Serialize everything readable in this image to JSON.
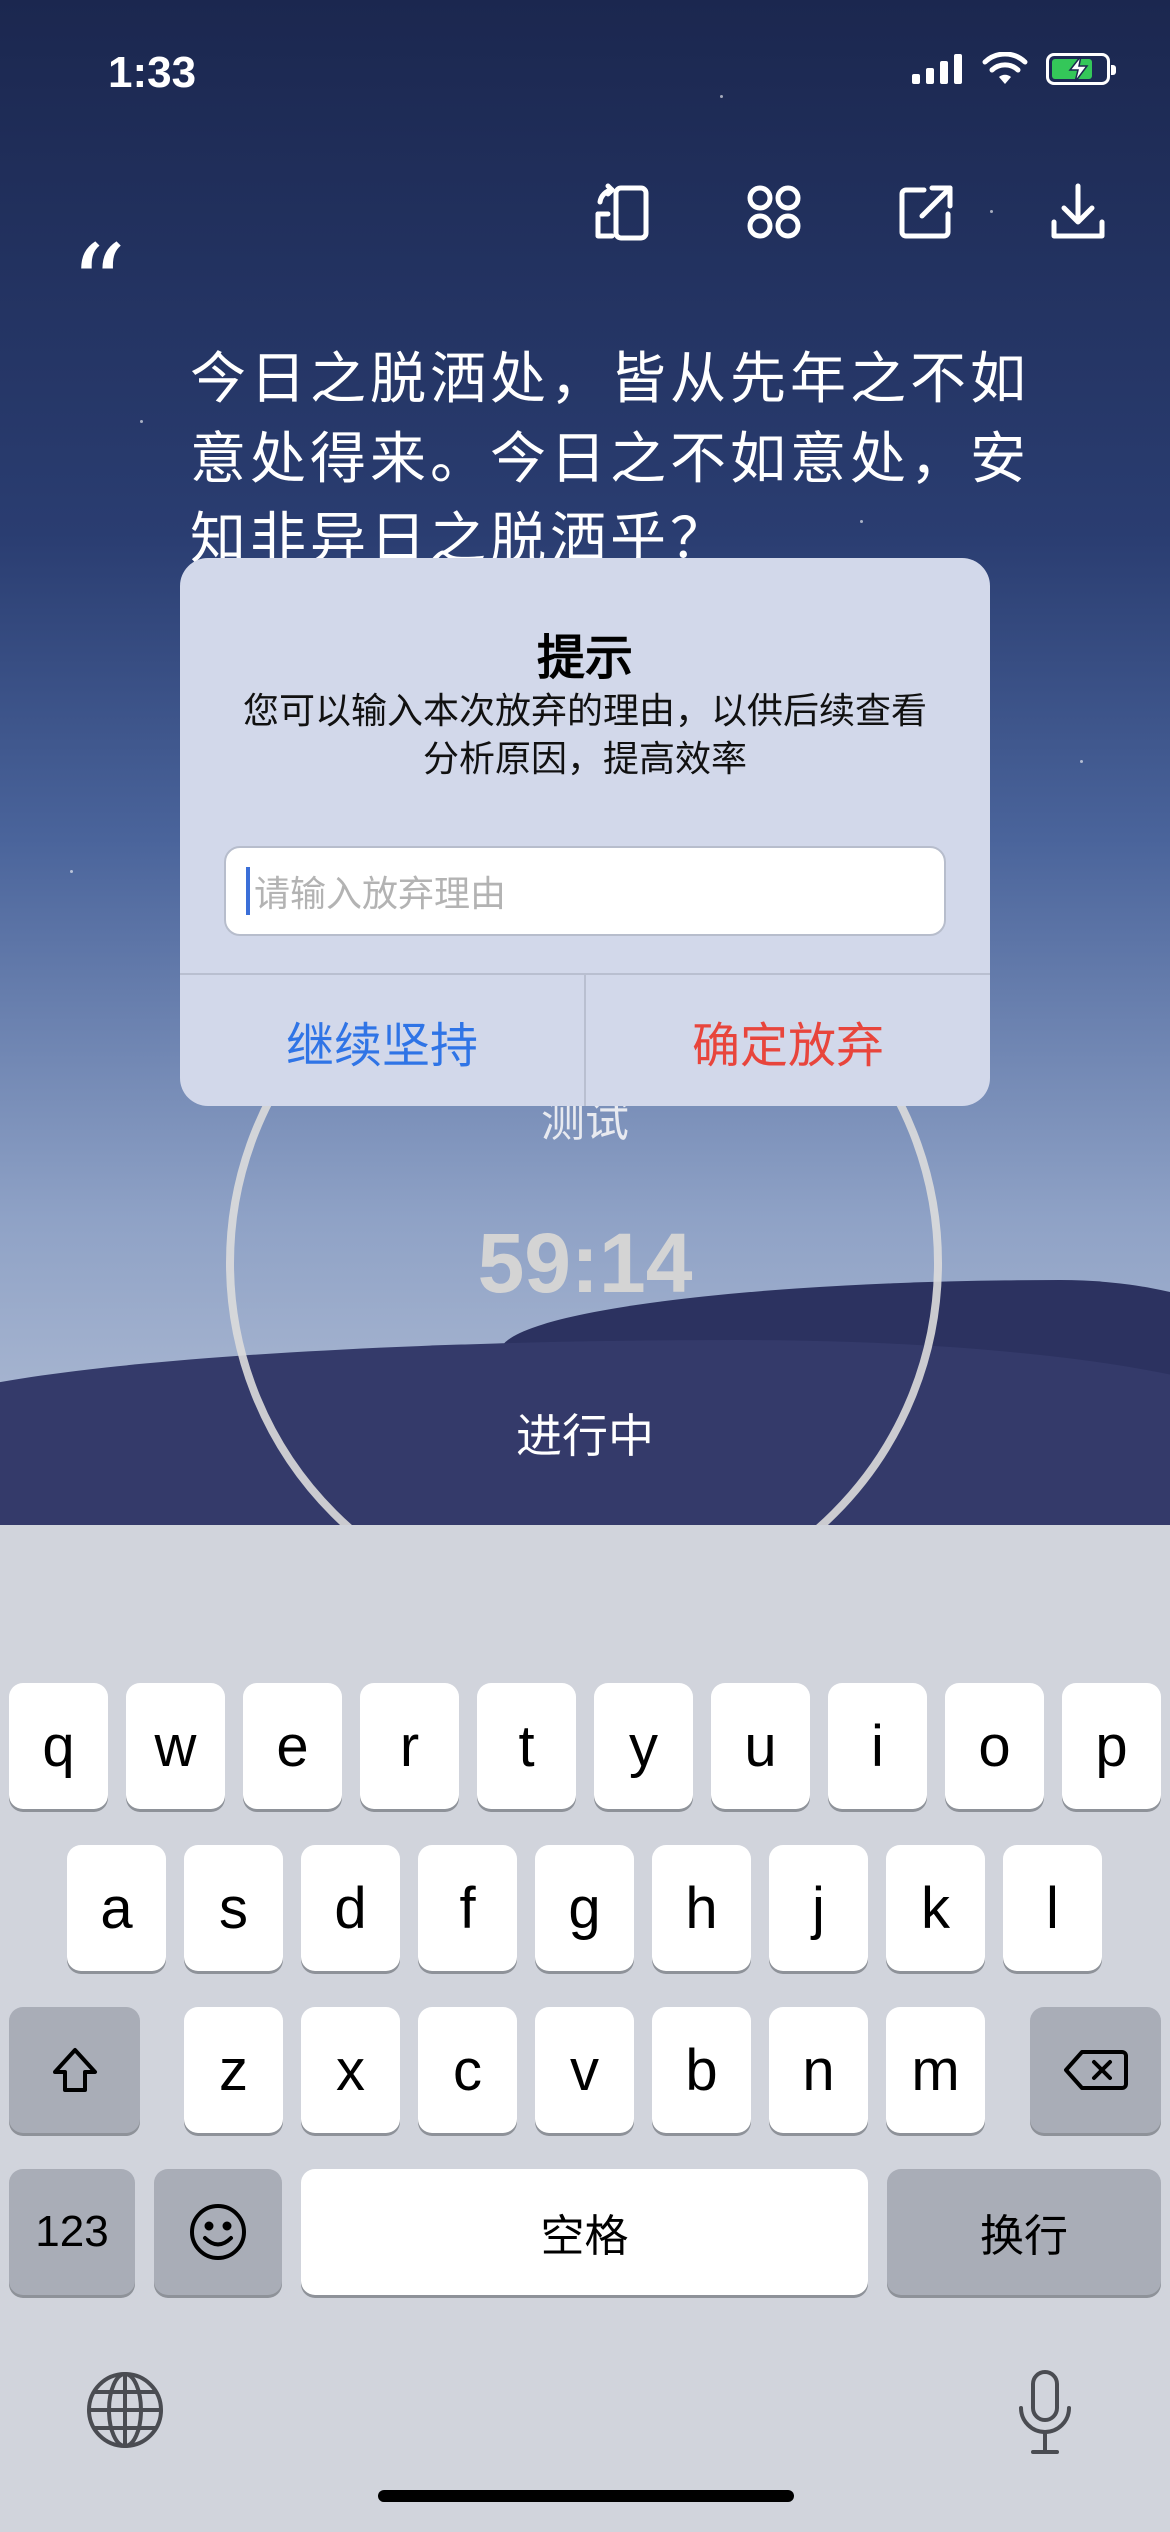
{
  "status_bar": {
    "time": "1:33",
    "icons": [
      "cellular-icon",
      "wifi-icon",
      "battery-charging-icon"
    ]
  },
  "toolbar": {
    "icons": [
      "rotate-icon",
      "apps-icon",
      "share-icon",
      "download-icon"
    ]
  },
  "quote": {
    "mark": "“",
    "text": "今日之脱洒处，皆从先年之不如意处得来。今日之不如意处，安知非异日之脱洒乎？"
  },
  "timer": {
    "task_name": "测试",
    "remaining": "59:14",
    "state": "进行中"
  },
  "alert": {
    "title": "提示",
    "message": "您可以输入本次放弃的理由，以供后续查看分析原因，提高效率",
    "input_placeholder": "请输入放弃理由",
    "input_value": "",
    "continue_label": "继续坚持",
    "confirm_label": "确定放弃"
  },
  "keyboard": {
    "row1": [
      "q",
      "w",
      "e",
      "r",
      "t",
      "y",
      "u",
      "i",
      "o",
      "p"
    ],
    "row2": [
      "a",
      "s",
      "d",
      "f",
      "g",
      "h",
      "j",
      "k",
      "l"
    ],
    "row3": [
      "z",
      "x",
      "c",
      "v",
      "b",
      "n",
      "m"
    ],
    "numbers_label": "123",
    "space_label": "空格",
    "return_label": "换行"
  },
  "colors": {
    "accent_blue": "#2f74e6",
    "destructive_red": "#e8453c",
    "battery_green": "#34c759"
  }
}
